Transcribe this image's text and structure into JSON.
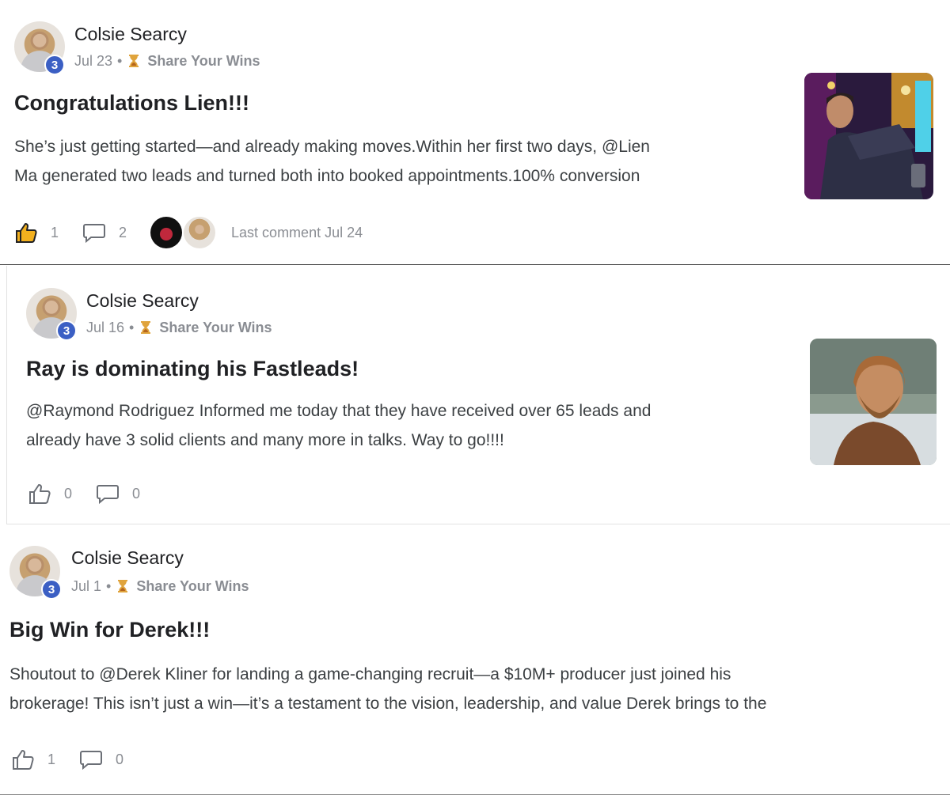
{
  "posts": [
    {
      "author": "Colsie Searcy",
      "level": "3",
      "date": "Jul 23",
      "category": "Share Your Wins",
      "title": "Congratulations Lien!!!",
      "body_line1": "She’s just getting started—and already making moves.Within her first two days, @Lien",
      "body_line2": "Ma generated two leads and turned both into booked appointments.100% conversion",
      "likes": "1",
      "comments": "2",
      "last_comment": "Last comment Jul 24"
    },
    {
      "author": "Colsie Searcy",
      "level": "3",
      "date": "Jul 16",
      "category": "Share Your Wins",
      "title": "Ray is dominating his Fastleads!",
      "body_line1": "@Raymond Rodriguez Informed me today that they have received over 65 leads and",
      "body_line2": "already have 3 solid clients and many more in talks. Way to go!!!!",
      "likes": "0",
      "comments": "0"
    },
    {
      "author": "Colsie Searcy",
      "level": "3",
      "date": "Jul 1",
      "category": "Share Your Wins",
      "title": "Big Win for Derek!!!",
      "body_line1": "Shoutout to @Derek Kliner for landing a game-changing recruit—a $10M+ producer just joined his",
      "body_line2": "brokerage! This isn’t just a win—it’s a testament to the vision, leadership, and value Derek brings to the",
      "likes": "1",
      "comments": "0"
    }
  ],
  "separator": "•",
  "colors": {
    "level_badge": "#3b5fc4",
    "muted": "#8a8d93",
    "liked_icon": "#f2b01e"
  }
}
